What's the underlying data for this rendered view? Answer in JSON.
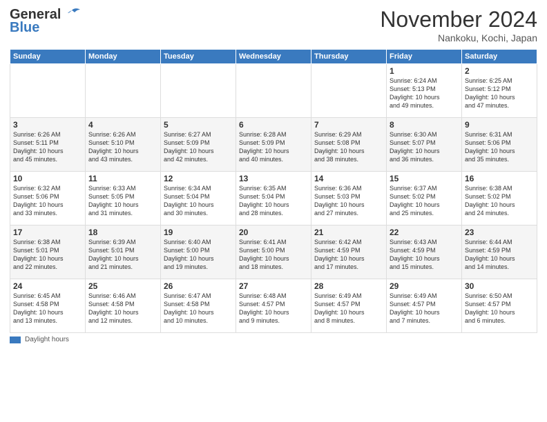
{
  "header": {
    "logo_line1": "General",
    "logo_line2": "Blue",
    "month_title": "November 2024",
    "location": "Nankoku, Kochi, Japan"
  },
  "weekdays": [
    "Sunday",
    "Monday",
    "Tuesday",
    "Wednesday",
    "Thursday",
    "Friday",
    "Saturday"
  ],
  "weeks": [
    [
      {
        "day": "",
        "info": ""
      },
      {
        "day": "",
        "info": ""
      },
      {
        "day": "",
        "info": ""
      },
      {
        "day": "",
        "info": ""
      },
      {
        "day": "",
        "info": ""
      },
      {
        "day": "1",
        "info": "Sunrise: 6:24 AM\nSunset: 5:13 PM\nDaylight: 10 hours\nand 49 minutes."
      },
      {
        "day": "2",
        "info": "Sunrise: 6:25 AM\nSunset: 5:12 PM\nDaylight: 10 hours\nand 47 minutes."
      }
    ],
    [
      {
        "day": "3",
        "info": "Sunrise: 6:26 AM\nSunset: 5:11 PM\nDaylight: 10 hours\nand 45 minutes."
      },
      {
        "day": "4",
        "info": "Sunrise: 6:26 AM\nSunset: 5:10 PM\nDaylight: 10 hours\nand 43 minutes."
      },
      {
        "day": "5",
        "info": "Sunrise: 6:27 AM\nSunset: 5:09 PM\nDaylight: 10 hours\nand 42 minutes."
      },
      {
        "day": "6",
        "info": "Sunrise: 6:28 AM\nSunset: 5:09 PM\nDaylight: 10 hours\nand 40 minutes."
      },
      {
        "day": "7",
        "info": "Sunrise: 6:29 AM\nSunset: 5:08 PM\nDaylight: 10 hours\nand 38 minutes."
      },
      {
        "day": "8",
        "info": "Sunrise: 6:30 AM\nSunset: 5:07 PM\nDaylight: 10 hours\nand 36 minutes."
      },
      {
        "day": "9",
        "info": "Sunrise: 6:31 AM\nSunset: 5:06 PM\nDaylight: 10 hours\nand 35 minutes."
      }
    ],
    [
      {
        "day": "10",
        "info": "Sunrise: 6:32 AM\nSunset: 5:06 PM\nDaylight: 10 hours\nand 33 minutes."
      },
      {
        "day": "11",
        "info": "Sunrise: 6:33 AM\nSunset: 5:05 PM\nDaylight: 10 hours\nand 31 minutes."
      },
      {
        "day": "12",
        "info": "Sunrise: 6:34 AM\nSunset: 5:04 PM\nDaylight: 10 hours\nand 30 minutes."
      },
      {
        "day": "13",
        "info": "Sunrise: 6:35 AM\nSunset: 5:04 PM\nDaylight: 10 hours\nand 28 minutes."
      },
      {
        "day": "14",
        "info": "Sunrise: 6:36 AM\nSunset: 5:03 PM\nDaylight: 10 hours\nand 27 minutes."
      },
      {
        "day": "15",
        "info": "Sunrise: 6:37 AM\nSunset: 5:02 PM\nDaylight: 10 hours\nand 25 minutes."
      },
      {
        "day": "16",
        "info": "Sunrise: 6:38 AM\nSunset: 5:02 PM\nDaylight: 10 hours\nand 24 minutes."
      }
    ],
    [
      {
        "day": "17",
        "info": "Sunrise: 6:38 AM\nSunset: 5:01 PM\nDaylight: 10 hours\nand 22 minutes."
      },
      {
        "day": "18",
        "info": "Sunrise: 6:39 AM\nSunset: 5:01 PM\nDaylight: 10 hours\nand 21 minutes."
      },
      {
        "day": "19",
        "info": "Sunrise: 6:40 AM\nSunset: 5:00 PM\nDaylight: 10 hours\nand 19 minutes."
      },
      {
        "day": "20",
        "info": "Sunrise: 6:41 AM\nSunset: 5:00 PM\nDaylight: 10 hours\nand 18 minutes."
      },
      {
        "day": "21",
        "info": "Sunrise: 6:42 AM\nSunset: 4:59 PM\nDaylight: 10 hours\nand 17 minutes."
      },
      {
        "day": "22",
        "info": "Sunrise: 6:43 AM\nSunset: 4:59 PM\nDaylight: 10 hours\nand 15 minutes."
      },
      {
        "day": "23",
        "info": "Sunrise: 6:44 AM\nSunset: 4:59 PM\nDaylight: 10 hours\nand 14 minutes."
      }
    ],
    [
      {
        "day": "24",
        "info": "Sunrise: 6:45 AM\nSunset: 4:58 PM\nDaylight: 10 hours\nand 13 minutes."
      },
      {
        "day": "25",
        "info": "Sunrise: 6:46 AM\nSunset: 4:58 PM\nDaylight: 10 hours\nand 12 minutes."
      },
      {
        "day": "26",
        "info": "Sunrise: 6:47 AM\nSunset: 4:58 PM\nDaylight: 10 hours\nand 10 minutes."
      },
      {
        "day": "27",
        "info": "Sunrise: 6:48 AM\nSunset: 4:57 PM\nDaylight: 10 hours\nand 9 minutes."
      },
      {
        "day": "28",
        "info": "Sunrise: 6:49 AM\nSunset: 4:57 PM\nDaylight: 10 hours\nand 8 minutes."
      },
      {
        "day": "29",
        "info": "Sunrise: 6:49 AM\nSunset: 4:57 PM\nDaylight: 10 hours\nand 7 minutes."
      },
      {
        "day": "30",
        "info": "Sunrise: 6:50 AM\nSunset: 4:57 PM\nDaylight: 10 hours\nand 6 minutes."
      }
    ]
  ],
  "footer": {
    "legend_label": "Daylight hours"
  }
}
